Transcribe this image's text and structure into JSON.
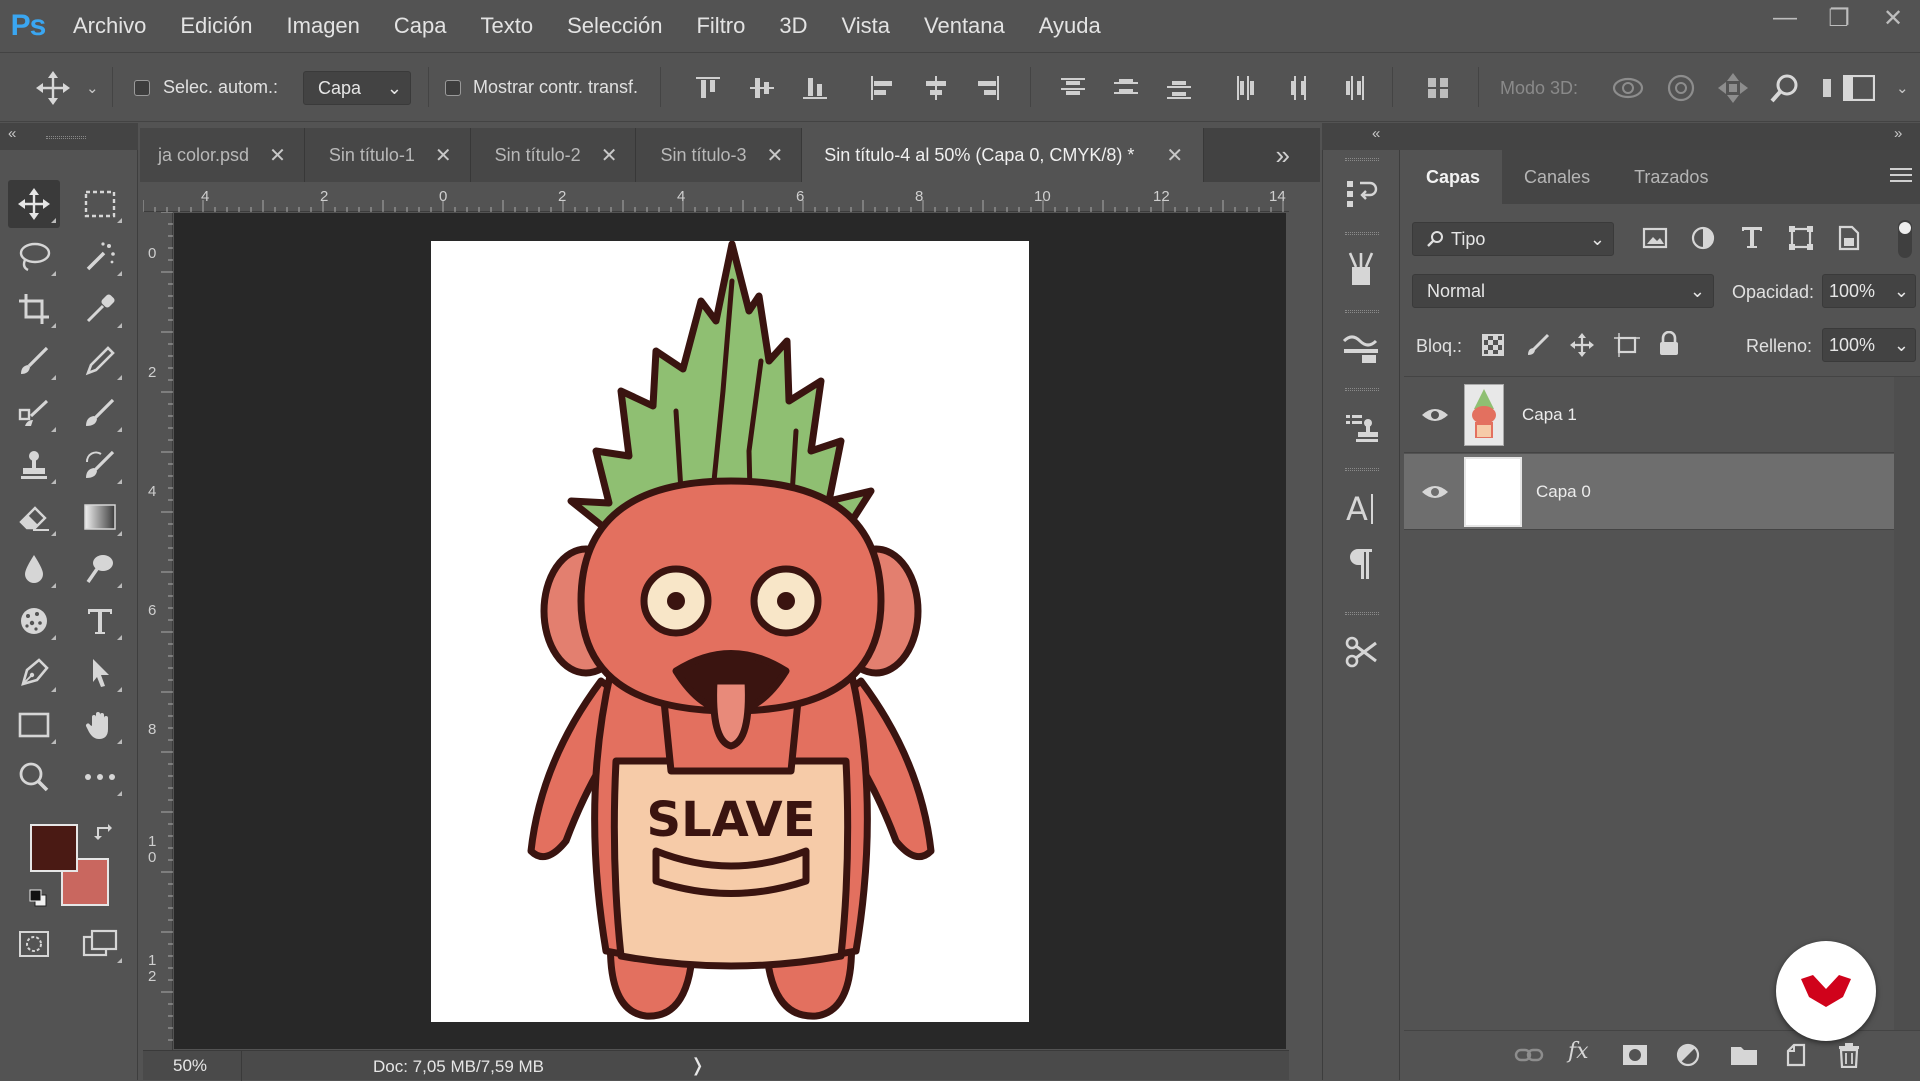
{
  "app": {
    "logo": "Ps"
  },
  "menu": [
    "Archivo",
    "Edición",
    "Imagen",
    "Capa",
    "Texto",
    "Selección",
    "Filtro",
    "3D",
    "Vista",
    "Ventana",
    "Ayuda"
  ],
  "window_controls": {
    "minimize": "—",
    "restore": "❐",
    "close": "✕"
  },
  "options": {
    "auto_select_label": "Selec. autom.:",
    "auto_select_checked": false,
    "auto_select_target": "Capa",
    "show_transform_label": "Mostrar contr. transf.",
    "show_transform_checked": false,
    "mode_3d_label": "Modo 3D:"
  },
  "tabs": [
    {
      "label": "ja color.psd",
      "active": false
    },
    {
      "label": "Sin título-1",
      "active": false
    },
    {
      "label": "Sin título-2",
      "active": false
    },
    {
      "label": "Sin título-3",
      "active": false
    },
    {
      "label": "Sin título-4 al 50% (Capa 0, CMYK/8) *",
      "active": true
    }
  ],
  "tabs_overflow": "»",
  "ruler": {
    "top_labels": [
      "4",
      "2",
      "0",
      "2",
      "4",
      "6",
      "8",
      "10",
      "12",
      "14"
    ],
    "left_labels": [
      "0",
      "2",
      "4",
      "6",
      "8",
      "1\n0",
      "1\n2"
    ]
  },
  "artwork": {
    "apron_text": "SLAVE"
  },
  "status": {
    "zoom": "50%",
    "doc_info": "Doc: 7,05 MB/7,59 MB",
    "arrow": "❭"
  },
  "colors": {
    "foreground": "#4a1a14",
    "background": "#c9675f",
    "accent_brand": "#d0021b"
  },
  "layers_panel": {
    "tabs": [
      {
        "label": "Capas",
        "active": true
      },
      {
        "label": "Canales",
        "active": false
      },
      {
        "label": "Trazados",
        "active": false
      }
    ],
    "filter_label": "Tipo",
    "blend_mode": "Normal",
    "opacity_label": "Opacidad:",
    "opacity_value": "100%",
    "lock_label": "Bloq.:",
    "fill_label": "Relleno:",
    "fill_value": "100%",
    "layers": [
      {
        "name": "Capa 1",
        "visible": true,
        "selected": false
      },
      {
        "name": "Capa 0",
        "visible": true,
        "selected": true
      }
    ]
  }
}
